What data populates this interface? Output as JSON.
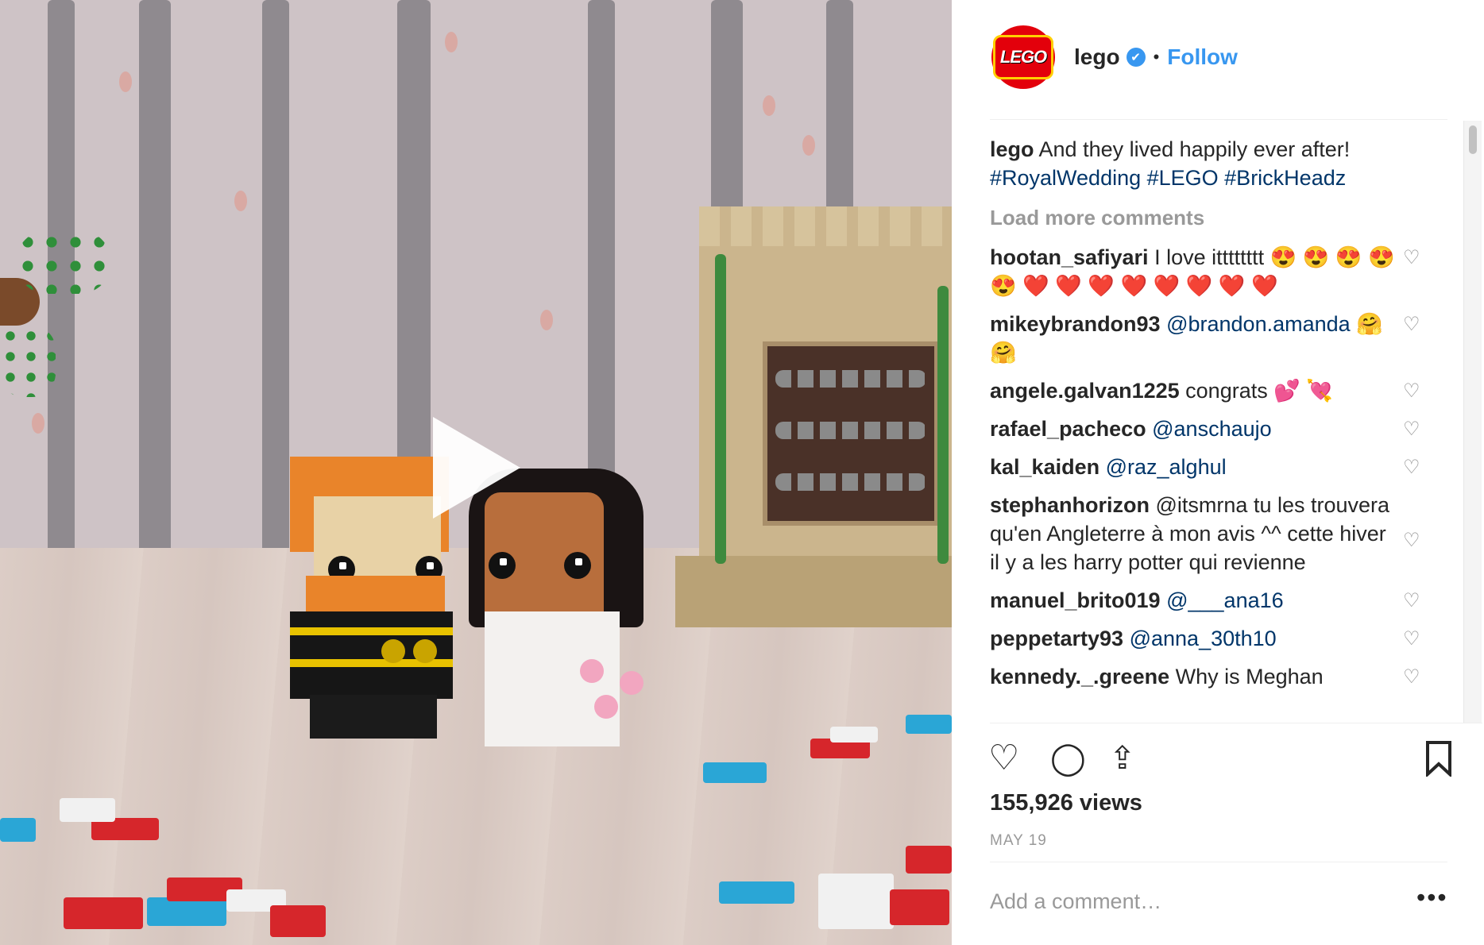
{
  "post": {
    "username": "lego",
    "follow_label": "Follow",
    "avatar_text": "LEGO",
    "verified_icon": "✔",
    "separator_dot": "•"
  },
  "caption": {
    "username": "lego",
    "text": "And they lived happily ever after!",
    "hashtags": "#RoyalWedding #LEGO #BrickHeadz"
  },
  "load_more": "Load more comments",
  "comments": [
    {
      "user": "hootan_safiyari",
      "text": "I love itttttttt 😍 😍 😍 😍 😍 ❤️ ❤️ ❤️ ❤️ ❤️ ❤️ ❤️ ❤️"
    },
    {
      "user": "mikeybrandon93",
      "text": "@brandon.amanda 🤗 🤗"
    },
    {
      "user": "angele.galvan1225",
      "text": "congrats 💕 💘"
    },
    {
      "user": "rafael_pacheco",
      "text": "@anschaujo"
    },
    {
      "user": "kal_kaiden",
      "text": "@raz_alghul"
    },
    {
      "user": "stephanhorizon",
      "text": "@itsmrna tu les trouvera qu'en Angleterre à mon avis ^^ cette hiver il y a les harry potter qui revienne"
    },
    {
      "user": "manuel_brito019",
      "text": "@___ana16"
    },
    {
      "user": "peppetarty93",
      "text": "@anna_30th10"
    },
    {
      "user": "kennedy._.greene",
      "text": "Why is Meghan"
    }
  ],
  "views": "155,926 views",
  "date": "MAY 19",
  "add_comment_placeholder": "Add a comment…",
  "more_label": "•••",
  "icons": {
    "heart": "♡",
    "comment": "◯",
    "share": "⇪",
    "bookmark": "🔖",
    "play": "play-icon"
  },
  "colors": {
    "link": "#3897f0",
    "hashtag": "#003569",
    "muted": "#999999",
    "lego_red": "#e3000b"
  }
}
